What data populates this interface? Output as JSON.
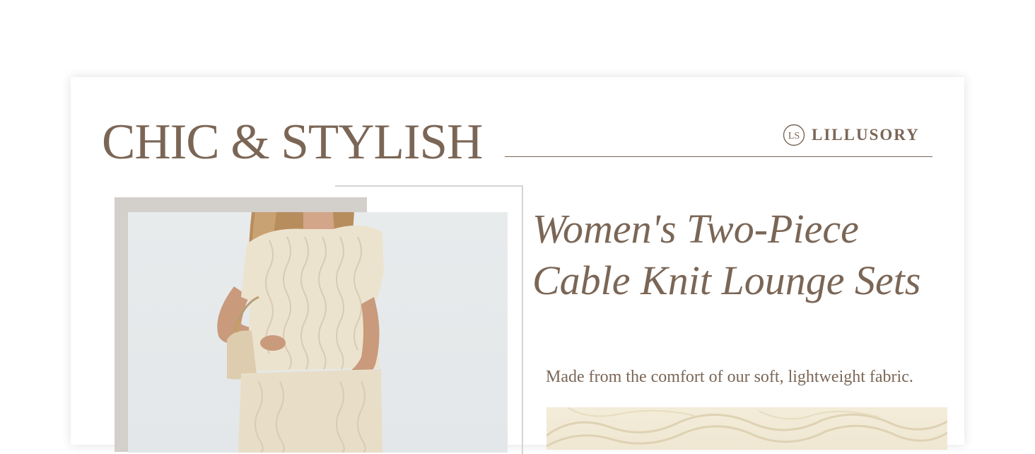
{
  "header": {
    "headline": "CHIC & STYLISH",
    "brand_name": "LILLUSORY",
    "brand_monogram": "LS"
  },
  "product": {
    "title_line1": "Women's Two-Piece",
    "title_line2": "Cable Knit Lounge Sets",
    "description": "Made from the comfort of our soft, lightweight fabric."
  },
  "colors": {
    "text_brown": "#7b6656",
    "frame_gray": "#d3cfcb",
    "frame_outline": "#d6d4d2",
    "photo_background": "#e6e9eb",
    "knit_cream": "#f1e9d6"
  },
  "icons": {
    "brand_logo": "ls-monogram-icon"
  },
  "images": {
    "product_photo": "model wearing cream cable knit two-piece lounge set",
    "fabric_detail": "cream cable knit fabric close-up"
  }
}
